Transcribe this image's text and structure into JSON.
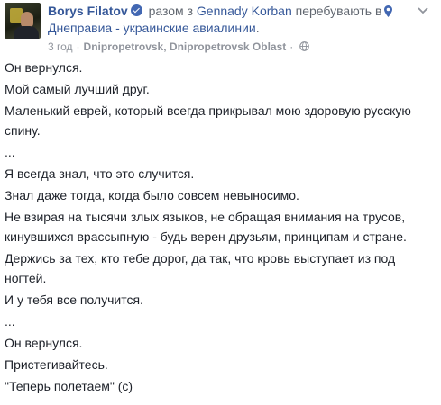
{
  "author": {
    "name": "Borys Filatov"
  },
  "headline": {
    "with_text": "разом з",
    "tagged": "Gennady Korban",
    "location_text": "перебувають в",
    "location_name": "Днеправиа - украинские авиалинии",
    "end": "."
  },
  "meta": {
    "time": "3 год",
    "separator": "·",
    "place": "Dnipropetrovsk, Dnipropetrovsk Oblast",
    "privacy_separator": "·"
  },
  "post": {
    "lines": [
      "Он вернулся.",
      "Мой самый лучший друг.",
      "Маленький еврей, который всегда прикрывал мою здоровую русскую спину.",
      "...",
      "Я всегда знал, что это случится.",
      "Знал даже тогда, когда было совсем невыносимо.",
      "Не взирая на тысячи злых языков, не обращая внимания на трусов, кинувшихся врассыпную - будь верен друзьям, принципам и стране.",
      "Держись за тех, кто тебе дорог, да так, что кровь выступает из под ногтей.",
      "И у тебя все получится.",
      "...",
      "Он вернулся.",
      "Пристегивайтесь.",
      "\"Теперь полетаем\" (c)"
    ]
  },
  "colors": {
    "link": "#365899",
    "text": "#1d2129",
    "meta": "#90949c",
    "verified": "#4267b2"
  }
}
